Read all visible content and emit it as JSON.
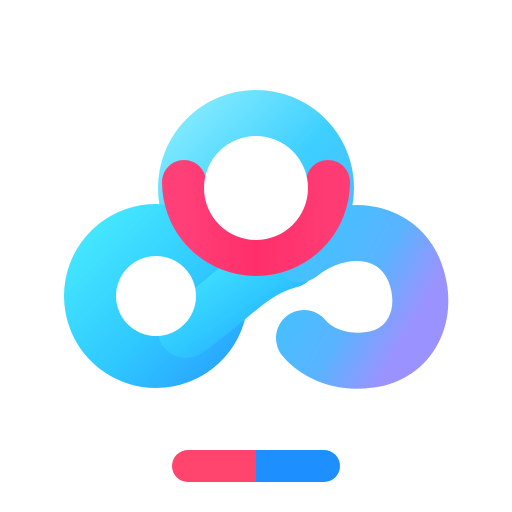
{
  "app": {
    "icon_name": "cloud-storage-logo-icon"
  },
  "colors": {
    "cyan_light": "#43e3ff",
    "cyan_mid": "#2ec9ff",
    "blue_mid": "#46a9ff",
    "violet_edge": "#8f93ff",
    "pink_ring": "#ff3b74",
    "pink_ring_light": "#ff5a7f",
    "bar_left": "#ff456e",
    "bar_right": "#1e8fff"
  }
}
